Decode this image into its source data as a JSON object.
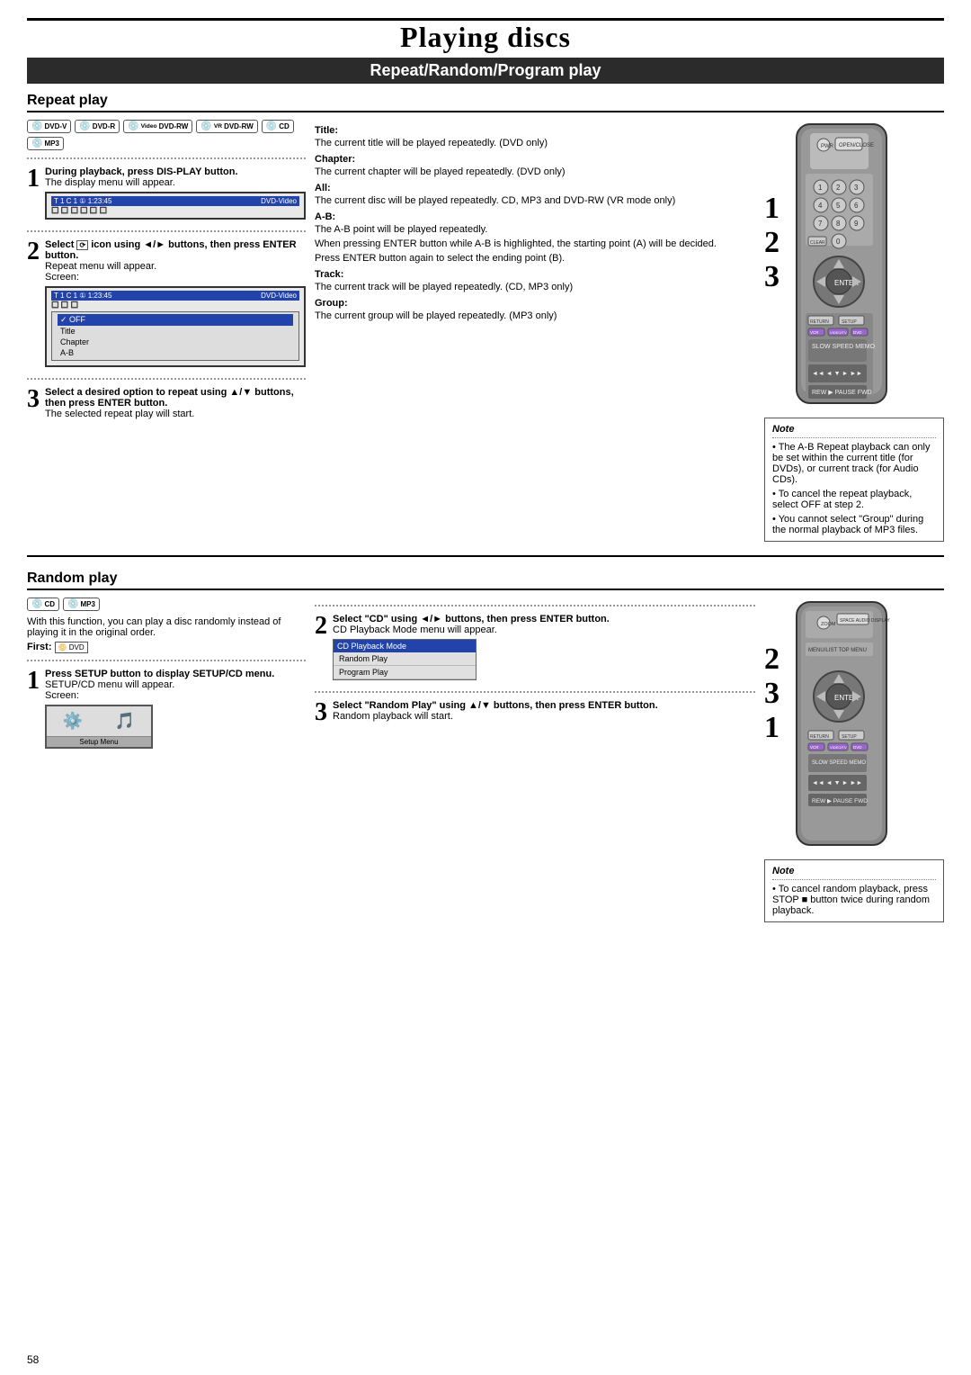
{
  "page": {
    "title": "Playing discs",
    "subtitle": "Repeat/Random/Program play",
    "page_number": "58"
  },
  "repeat_section": {
    "title": "Repeat play",
    "disc_icons": [
      "DVD-V",
      "DVD-R",
      "Video DVD-RW",
      "VR DVD-RW",
      "CD",
      "MP3"
    ],
    "steps": [
      {
        "number": "1",
        "bold": "During playback, press DIS-PLAY button.",
        "normal": "The display menu will appear."
      },
      {
        "number": "2",
        "bold": "Select  icon using ◄/► buttons, then press ENTER button.",
        "normal": "Repeat menu will appear.",
        "screen_label": "Screen:"
      },
      {
        "number": "3",
        "bold": "Select a desired option to repeat using ▲/▼ buttons, then press ENTER button.",
        "normal": "The selected repeat play will start."
      }
    ],
    "screen1": {
      "top_left": "T  1  C  1  ①  1:23:45",
      "top_right": "DVD-Video"
    },
    "screen2": {
      "top_left": "T  1  C  1  ①  1:23:45",
      "top_right": "DVD-Video",
      "menu_items": [
        "✓ OFF",
        "Title",
        "Chapter",
        "A-B"
      ]
    },
    "params": {
      "title": {
        "heading": "Title:",
        "text": "The current title will be played repeatedly. (DVD only)"
      },
      "chapter": {
        "heading": "Chapter:",
        "text": "The current chapter will be played repeatedly. (DVD only)"
      },
      "all": {
        "heading": "All:",
        "text": "The current disc will be played repeatedly. CD, MP3 and DVD-RW (VR mode only)"
      },
      "ab": {
        "heading": "A-B:",
        "text1": "The A-B point will be played repeatedly.",
        "text2": "When pressing ENTER button while A-B is highlighted, the starting point (A) will be decided.",
        "text3": "Press ENTER button again to select the ending point (B)."
      },
      "track": {
        "heading": "Track:",
        "text": "The current track will be played repeatedly. (CD, MP3 only)"
      },
      "group": {
        "heading": "Group:",
        "text": "The current group will be played repeatedly. (MP3 only)"
      }
    },
    "note": {
      "title": "Note",
      "items": [
        "• The A-B Repeat playback can only be set within the current title (for DVDs), or current track (for Audio CDs).",
        "• To cancel the repeat playback, select OFF at step 2.",
        "• You cannot select \"Group\" during the normal playback of MP3 files."
      ]
    }
  },
  "random_section": {
    "title": "Random play",
    "disc_icons": [
      "CD",
      "MP3"
    ],
    "intro": "With this function, you can play a disc randomly instead of playing it in the original order.",
    "first_label": "First:",
    "steps": [
      {
        "number": "1",
        "bold": "Press SETUP button to display SETUP/CD menu.",
        "normal": "SETUP/CD menu will appear.",
        "screen_label": "Screen:",
        "screen_sub": "Setup Menu"
      },
      {
        "number": "2",
        "bold": "Select \"CD\" using ◄/► buttons, then press ENTER button.",
        "normal": "CD Playback Mode menu will appear."
      },
      {
        "number": "3",
        "bold": "Select \"Random Play\" using ▲/▼ buttons, then press ENTER button.",
        "normal": "Random playback will start."
      }
    ],
    "cd_menu_items": [
      "CD Playback Mode",
      "Random Play",
      "Program Play"
    ],
    "note": {
      "title": "Note",
      "items": [
        "• To cancel random playback, press STOP ■ button twice during random playback."
      ]
    }
  },
  "step_numbers_right_1": [
    "1",
    "2",
    "3"
  ],
  "step_numbers_right_2": [
    "2",
    "3",
    "1"
  ]
}
